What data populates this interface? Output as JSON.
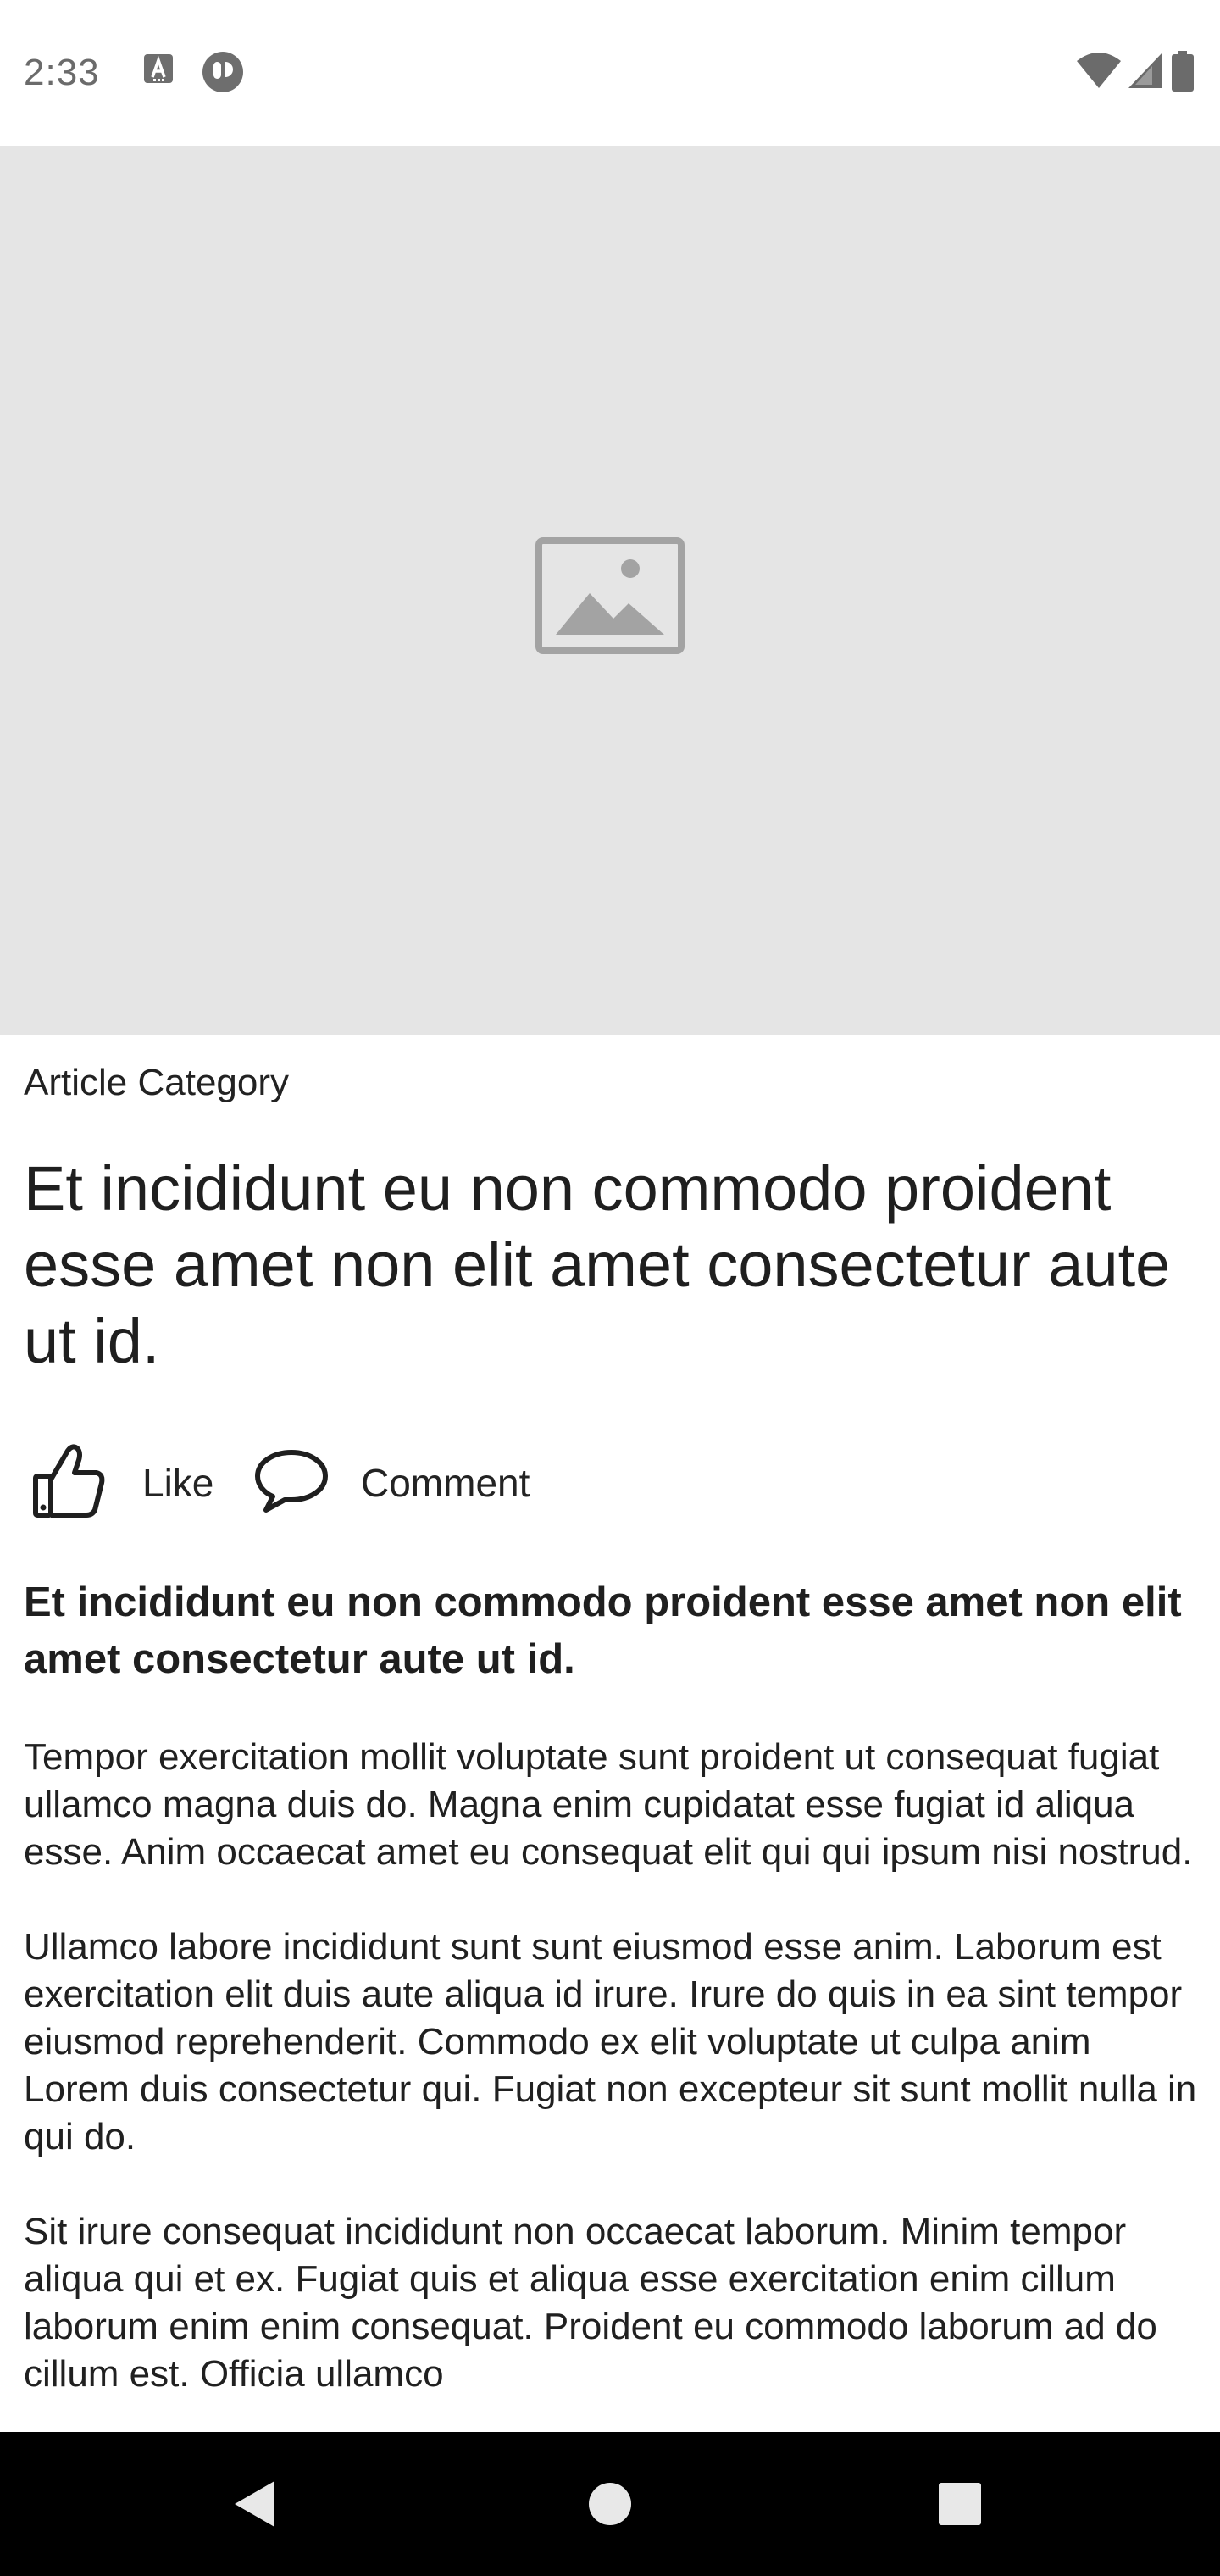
{
  "status_bar": {
    "time": "2:33",
    "left_icons": [
      "app-notification-icon",
      "circle-app-icon"
    ],
    "right_icons": [
      "wifi-icon",
      "cell-signal-icon",
      "battery-icon"
    ]
  },
  "hero": {
    "image_icon": "image-placeholder-icon",
    "background_color": "#e5e5e5"
  },
  "article": {
    "category": "Article Category",
    "headline": "Et incididunt eu non commodo proident esse amet non elit amet consectetur aute ut id.",
    "actions": [
      {
        "icon": "thumbs-up-icon",
        "label": "Like"
      },
      {
        "icon": "comment-icon",
        "label": "Comment"
      }
    ],
    "lead": "Et incididunt eu non commodo proident esse amet non elit amet consectetur aute ut id.",
    "paragraphs": [
      "Tempor exercitation mollit voluptate sunt proident ut consequat fugiat ullamco magna duis do. Magna enim cupidatat esse fugiat id aliqua esse. Anim occaecat amet eu consequat elit qui qui ipsum nisi nostrud.",
      "Ullamco labore incididunt sunt sunt eiusmod esse anim. Laborum est exercitation elit duis aute aliqua id irure. Irure do quis in ea sint tempor eiusmod reprehenderit. Commodo ex elit voluptate ut culpa anim Lorem duis consectetur qui. Fugiat non excepteur sit sunt mollit nulla in qui do.",
      "Sit irure consequat incididunt non occaecat laborum. Minim tempor aliqua qui et ex. Fugiat quis et aliqua esse exercitation enim cillum laborum enim enim consequat. Proident eu commodo laborum ad do cillum est. Officia ullamco"
    ]
  },
  "nav_bar": {
    "buttons": [
      "back-icon",
      "home-icon",
      "recents-icon"
    ],
    "background_color": "#000000"
  }
}
